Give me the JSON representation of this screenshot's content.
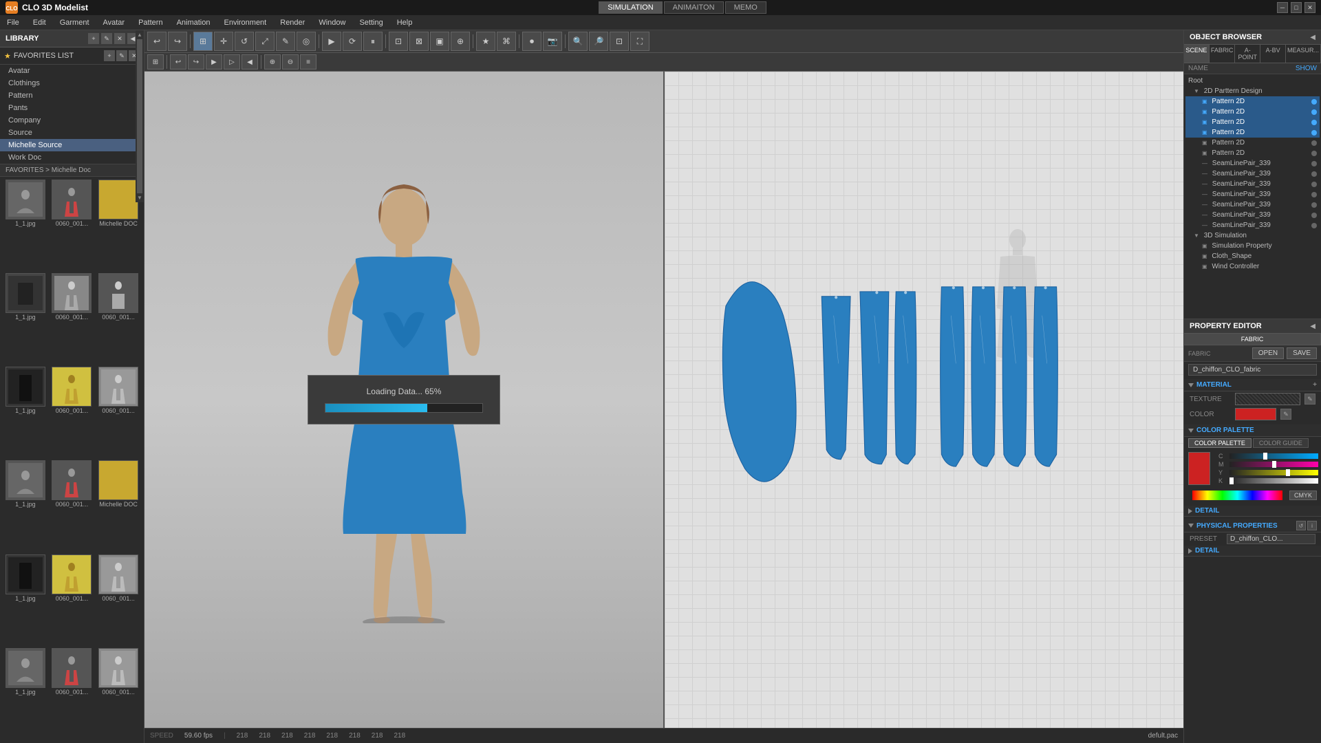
{
  "app": {
    "title": "CLO 3D Modelist",
    "logo_text": "CLO"
  },
  "top_tabs": [
    {
      "label": "SIMULATION",
      "active": true
    },
    {
      "label": "ANIMAITON",
      "active": false
    },
    {
      "label": "MEMO",
      "active": false
    }
  ],
  "menu": {
    "items": [
      "File",
      "Edit",
      "Garment",
      "Avatar",
      "Pattern",
      "Animation",
      "Environment",
      "Render",
      "Window",
      "Setting",
      "Help"
    ]
  },
  "library": {
    "title": "LIBRARY",
    "nav_items": [
      {
        "label": "Avatar"
      },
      {
        "label": "Clothings"
      },
      {
        "label": "Pattern"
      },
      {
        "label": "Pants"
      },
      {
        "label": "Company"
      },
      {
        "label": "Source"
      },
      {
        "label": "Michelle Source",
        "active": true
      },
      {
        "label": "Work Doc"
      }
    ],
    "breadcrumb": "FAVORITES > Michelle Doc",
    "thumbnails": [
      {
        "label": "1_1.jpg"
      },
      {
        "label": "0060_001..."
      },
      {
        "label": "Michelle DOC"
      },
      {
        "label": "1_1.jpg"
      },
      {
        "label": "0060_001..."
      },
      {
        "label": "0060_001..."
      },
      {
        "label": "1_1.jpg"
      },
      {
        "label": "0060_001..."
      },
      {
        "label": "0060_001..."
      },
      {
        "label": "1_1.jpg"
      },
      {
        "label": "0060_001..."
      },
      {
        "label": "Michelle DOC"
      },
      {
        "label": "1_1.jpg"
      },
      {
        "label": "0060_001..."
      },
      {
        "label": "0060_001..."
      },
      {
        "label": "1_1.jpg"
      },
      {
        "label": "0060_001..."
      },
      {
        "label": "0060_001..."
      }
    ]
  },
  "loading": {
    "text": "Loading Data... 65%",
    "progress": 65
  },
  "object_browser": {
    "title": "OBJECT BROWSER",
    "tabs": [
      "SCENE",
      "FABRIC",
      "A-POINT",
      "A-BV",
      "MEASUR..."
    ],
    "name_label": "NAME",
    "show_label": "SHOW",
    "tree": [
      {
        "indent": 0,
        "label": "Root",
        "type": "folder"
      },
      {
        "indent": 1,
        "label": "2D Parttern Design",
        "type": "folder"
      },
      {
        "indent": 2,
        "label": "Pattern 2D",
        "type": "item",
        "selected": true,
        "has_dot": true,
        "dot_active": true
      },
      {
        "indent": 2,
        "label": "Pattern 2D",
        "type": "item",
        "selected": true,
        "has_dot": true,
        "dot_active": true
      },
      {
        "indent": 2,
        "label": "Pattern 2D",
        "type": "item",
        "selected": true,
        "has_dot": true,
        "dot_active": true
      },
      {
        "indent": 2,
        "label": "Pattern 2D",
        "type": "item",
        "selected": true,
        "has_dot": true,
        "dot_active": true
      },
      {
        "indent": 2,
        "label": "Pattern 2D",
        "type": "item",
        "has_dot": true,
        "dot_active": false
      },
      {
        "indent": 2,
        "label": "Pattern 2D",
        "type": "item",
        "has_dot": true,
        "dot_active": false
      },
      {
        "indent": 2,
        "label": "SeamLinePair_339",
        "type": "item",
        "has_dot": true
      },
      {
        "indent": 2,
        "label": "SeamLinePair_339",
        "type": "item",
        "has_dot": true
      },
      {
        "indent": 2,
        "label": "SeamLinePair_339",
        "type": "item",
        "has_dot": true
      },
      {
        "indent": 2,
        "label": "SeamLinePair_339",
        "type": "item",
        "has_dot": true
      },
      {
        "indent": 2,
        "label": "SeamLinePair_339",
        "type": "item",
        "has_dot": true
      },
      {
        "indent": 2,
        "label": "SeamLinePair_339",
        "type": "item",
        "has_dot": true
      },
      {
        "indent": 2,
        "label": "SeamLinePair_339",
        "type": "item",
        "has_dot": true
      },
      {
        "indent": 1,
        "label": "3D Simulation",
        "type": "folder"
      },
      {
        "indent": 2,
        "label": "Simulation Property",
        "type": "item"
      },
      {
        "indent": 2,
        "label": "Cloth_Shape",
        "type": "item"
      },
      {
        "indent": 2,
        "label": "Wind Controller",
        "type": "item"
      }
    ]
  },
  "property_editor": {
    "title": "PROPERTY EDITOR",
    "tabs": [
      "FABRIC"
    ],
    "open_label": "OPEN",
    "save_label": "SAVE",
    "fabric_name": "D_chiffon_CLO_fabric",
    "sections": {
      "material": {
        "title": "MATERIAL",
        "expand_icon": "+",
        "texture_label": "TEXTURE",
        "color_label": "COLOR",
        "color_value": "#cc2222"
      },
      "color_palette": {
        "title": "COLOR PALETTE",
        "tabs": [
          "COLOR PALETTE",
          "COLOR GUIDE"
        ],
        "cmyk": {
          "c_value": 40,
          "m_value": 50,
          "y_value": 67,
          "k_value": 0
        },
        "button_label": "CMYK"
      },
      "detail": {
        "title": "DETAIL"
      },
      "physical_properties": {
        "title": "PHYSICAL PROPERTIES",
        "preset_label": "PRESET",
        "preset_value": "D_chiffon_CLO...",
        "detail_label": "DETAIL"
      }
    }
  },
  "status_bar": {
    "speed_label": "SPEED",
    "speed_value": "59.60 fps",
    "coords": [
      218,
      218,
      218,
      218,
      218,
      218,
      218,
      218
    ],
    "pac_file": "defult.pac"
  },
  "toolbar_icons": {
    "top_3d": [
      "↩",
      "↪",
      "⊞",
      "⊕",
      "⊖",
      "▣",
      "◎",
      "⌖",
      "★",
      "⌘",
      "⊡",
      "✂",
      "⊕",
      "✦",
      "☰",
      "⊞",
      "⊠",
      "☆",
      "⊗",
      "⊕"
    ],
    "bottom_3d": [
      "⊡",
      "▶",
      "◼",
      "▷",
      "◻",
      "⊕",
      "⊞"
    ],
    "top_2d": [
      "↩",
      "↪",
      "⊞",
      "⊕",
      "⊖",
      "▣",
      "◎",
      "⌖",
      "★",
      "⌘",
      "⊡",
      "✂",
      "⊕",
      "✦"
    ],
    "bottom_2d": [
      "⊡",
      "▶",
      "◼",
      "▷",
      "◻",
      "⊕",
      "⊞"
    ]
  }
}
